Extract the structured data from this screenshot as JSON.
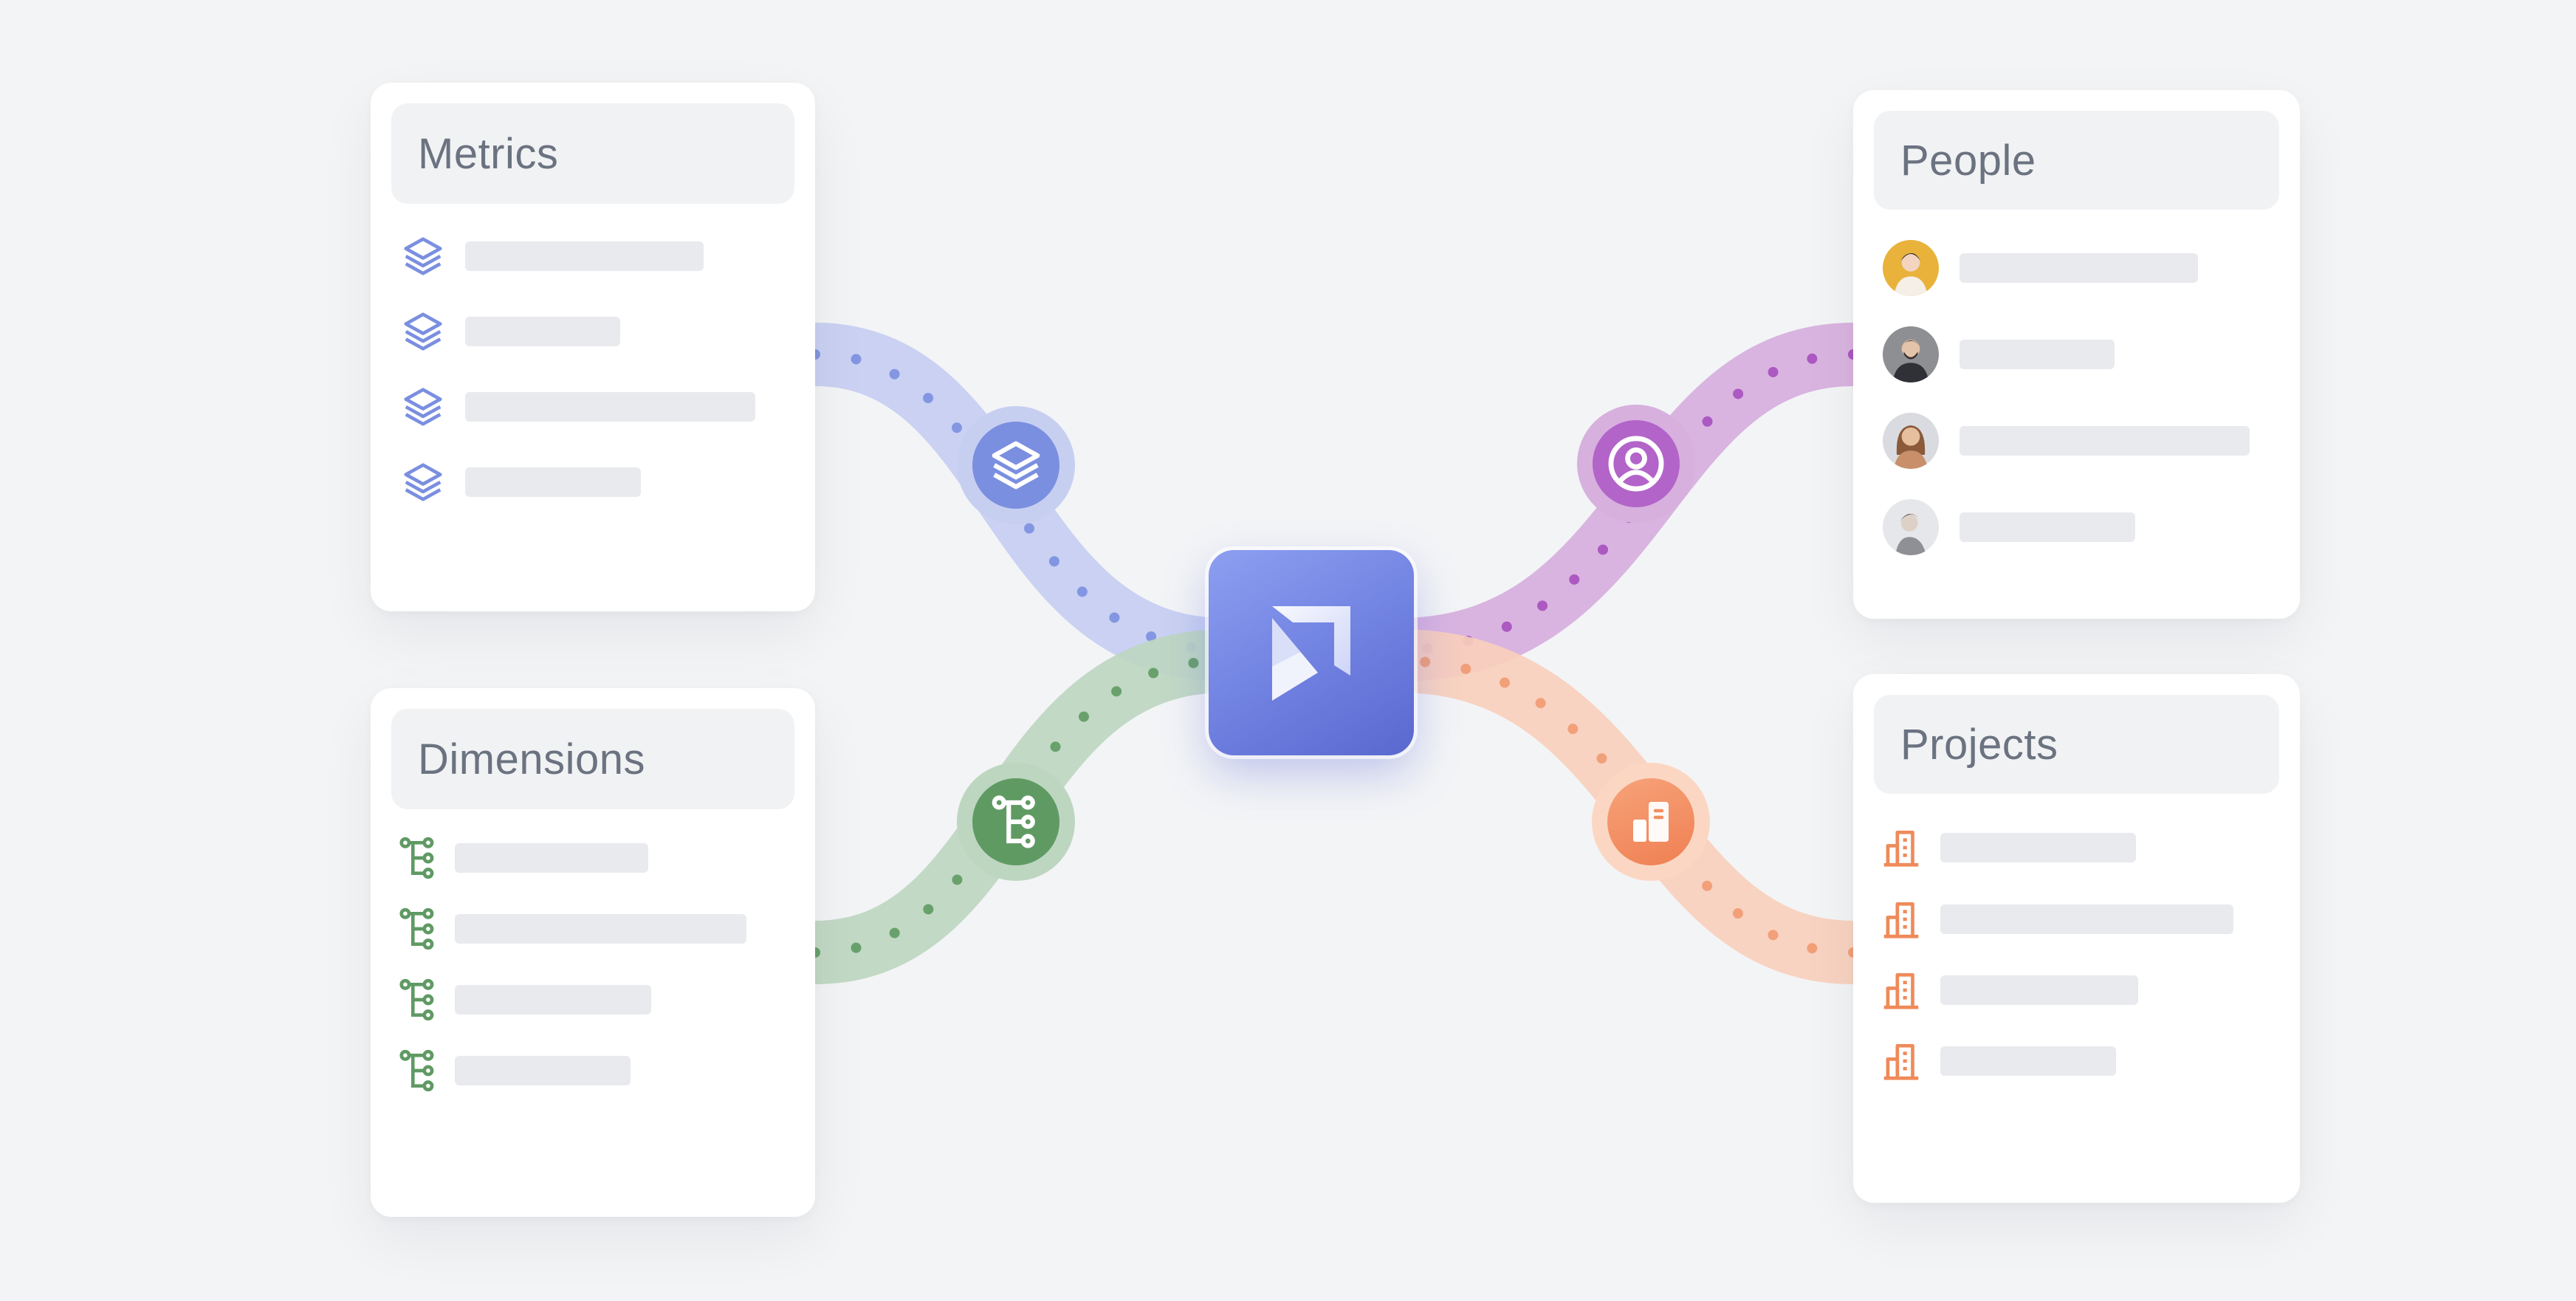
{
  "cards": {
    "metrics": {
      "title": "Metrics",
      "icon": "stack-layers-icon",
      "color": "#7b8fe0"
    },
    "dimensions": {
      "title": "Dimensions",
      "icon": "tree-hierarchy-icon",
      "color": "#5f9a63"
    },
    "people": {
      "title": "People",
      "icon": "user-avatar",
      "color": "#b264c9"
    },
    "projects": {
      "title": "Projects",
      "icon": "buildings-icon",
      "color": "#ef8a5a"
    }
  },
  "hub": {
    "icon": "app-logo-arrow-icon"
  },
  "connectors": {
    "metrics": "#c7cff1",
    "dimensions": "#bdd6c0",
    "people": "#d7b0de",
    "projects": "#f8cfbb"
  }
}
